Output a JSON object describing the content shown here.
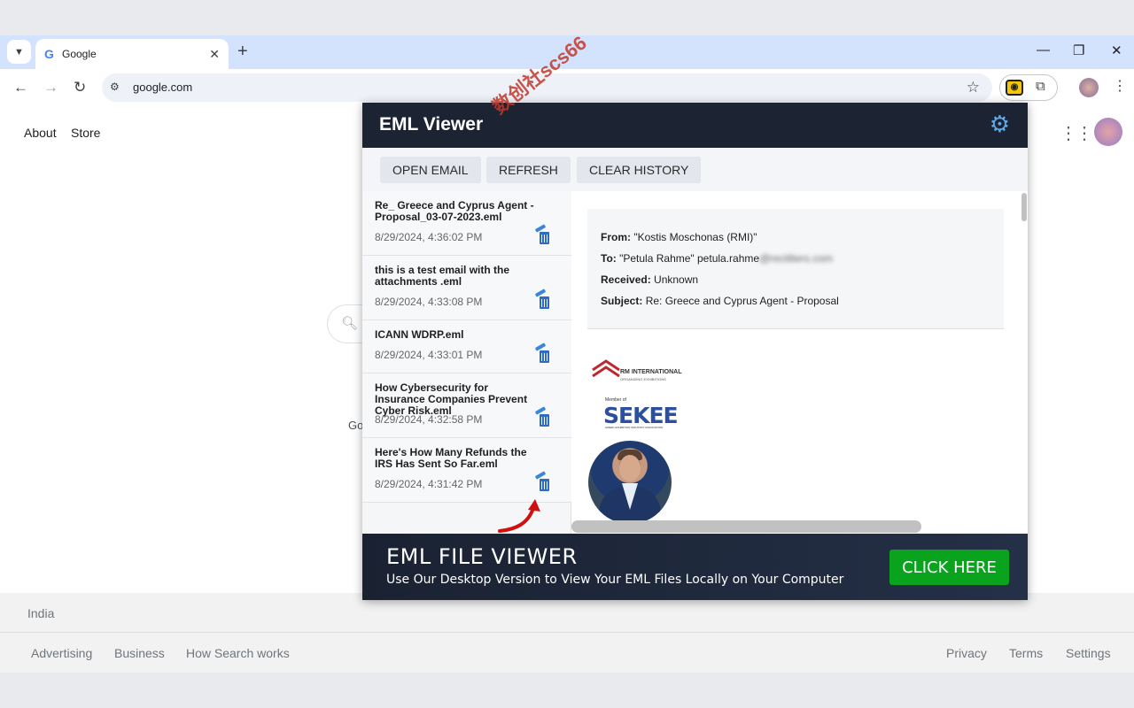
{
  "browser": {
    "tab_title": "Google",
    "tab_favicon": "G",
    "tab_close": "✕",
    "new_tab": "+",
    "window_controls": [
      "—",
      "❐",
      "✕"
    ],
    "url": "google.com",
    "nav": {
      "back": "←",
      "forward": "→",
      "reload": "↻"
    },
    "icons": [
      "chevron-down-icon",
      "google-favicon",
      "close-icon",
      "plus-icon",
      "back-icon",
      "forward-icon",
      "reload-icon",
      "site-settings-icon",
      "star-icon",
      "eml-extension-icon",
      "puzzle-icon",
      "profile-avatar",
      "kebab-menu-icon"
    ]
  },
  "google": {
    "top_links": [
      "About",
      "Store"
    ],
    "partial_text": "Go",
    "country": "India",
    "footer_left": [
      "Advertising",
      "Business",
      "How Search works"
    ],
    "footer_right": [
      "Privacy",
      "Terms",
      "Settings"
    ]
  },
  "watermark": "数创社scs66",
  "popup": {
    "title": "EML Viewer",
    "buttons": [
      "OPEN EMAIL",
      "REFRESH",
      "CLEAR HISTORY"
    ],
    "emails": [
      {
        "name": "Re_ Greece and Cyprus Agent - Proposal_03-07-2023.eml",
        "date": "8/29/2024, 4:36:02 PM"
      },
      {
        "name": "this is a test email with the attachments .eml",
        "date": "8/29/2024, 4:33:08 PM"
      },
      {
        "name": "ICANN WDRP.eml",
        "date": "8/29/2024, 4:33:01 PM"
      },
      {
        "name": "How Cybersecurity for Insurance Companies Prevent Cyber Risk.eml",
        "date": "8/29/2024, 4:32:58 PM"
      },
      {
        "name": "Here's How Many Refunds the IRS Has Sent So Far.eml",
        "date": "8/29/2024, 4:31:42 PM"
      }
    ],
    "meta": {
      "from_label": "From:",
      "from_value": "\"Kostis Moschonas (RMI)\"",
      "to_label": "To:",
      "to_value": "\"Petula Rahme\" petula.rahme",
      "to_blurred": "@rectiliers.com",
      "received_label": "Received:",
      "received_value": "Unknown",
      "subject_label": "Subject:",
      "subject_value": "Re: Greece and Cyprus Agent - Proposal"
    },
    "logos": {
      "rmi_title": "RM INTERNATIONAL",
      "rmi_sub": "ORGANIZING EXHIBITIONS",
      "sekee_member": "Member of",
      "sekee_name": "SEKEE",
      "sekee_sub": "GREEK EXHIBITION INDUSTRY ASSOCIATION"
    },
    "banner": {
      "title": "EML FILE VIEWER",
      "subtitle": "Use Our Desktop Version to View Your EML Files Locally on Your Computer",
      "cta": "CLICK HERE"
    }
  },
  "colors": {
    "popup_header": "#1c2333",
    "cta_green": "#0aa31e",
    "gear_blue": "#5fa8e8",
    "tabstrip": "#d3e3fd"
  }
}
